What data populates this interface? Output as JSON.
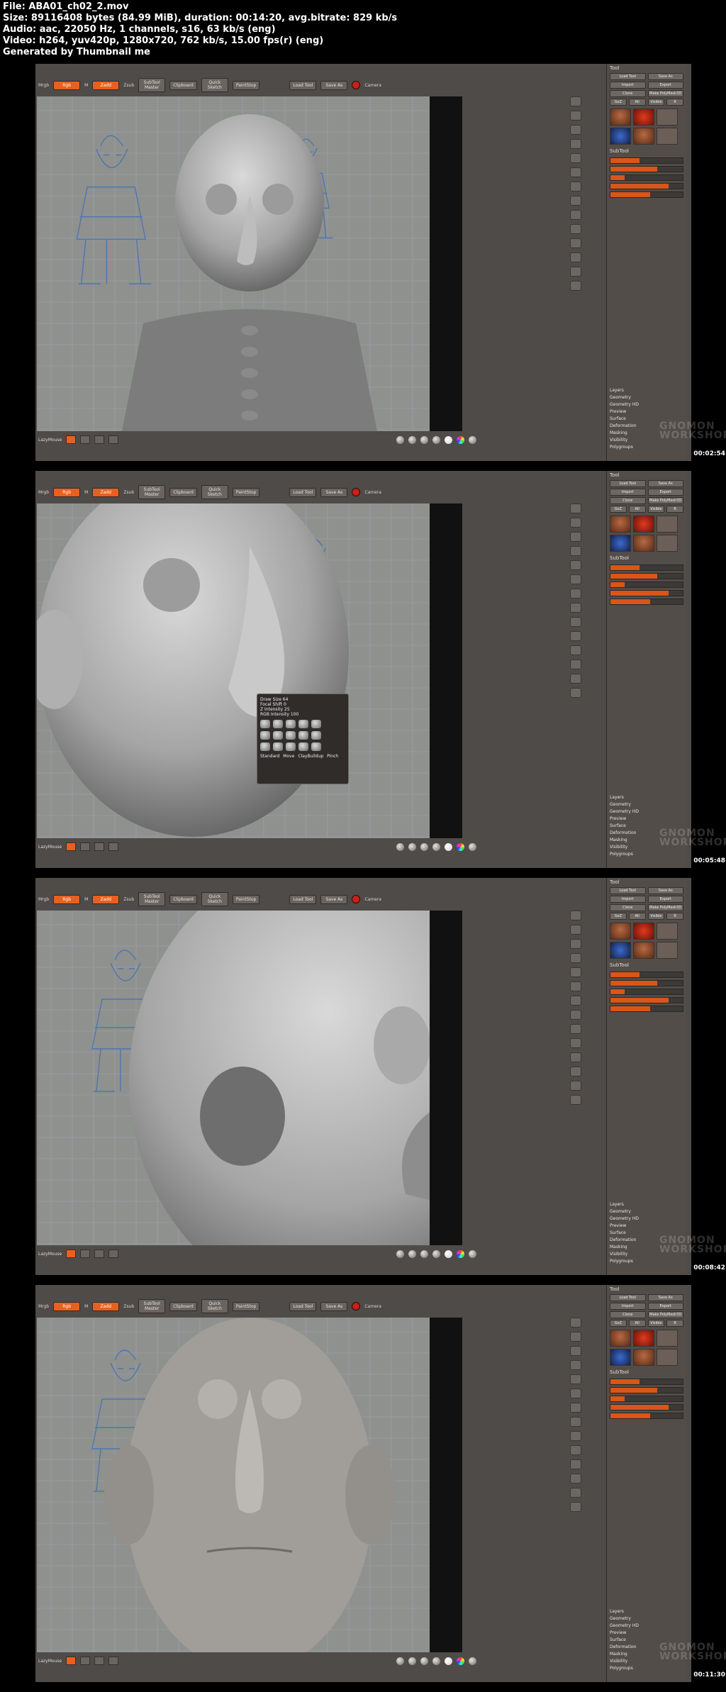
{
  "file_info": {
    "file": "File: ABA01_ch02_2.mov",
    "size": "Size: 89116408 bytes (84.99 MiB), duration: 00:14:20, avg.bitrate: 829 kb/s",
    "audio": "Audio: aac, 22050 Hz, 1 channels, s16, 63 kb/s (eng)",
    "video": "Video: h264, yuv420p, 1280x720, 762 kb/s, 15.00 fps(r) (eng)",
    "generated": "Generated by Thumbnail me"
  },
  "frames": [
    {
      "timestamp": "00:02:54",
      "has_popup": false
    },
    {
      "timestamp": "00:05:48",
      "has_popup": true
    },
    {
      "timestamp": "00:08:42",
      "has_popup": false
    },
    {
      "timestamp": "00:11:30",
      "has_popup": false
    }
  ],
  "watermark": {
    "line1": "GNOMON",
    "line2": "WORKSHOP"
  },
  "toolbar": {
    "mrgb": "Mrgb",
    "rgb": "Rgb",
    "m": "M",
    "zadd": "Zadd",
    "zsub": "Zsub",
    "subtool_master": "SubTool\nMaster",
    "clipboard": "Clipboard",
    "quick_sketch": "Quick\nSketch",
    "paintstop": "PaintStop",
    "load_tool": "Load Tool",
    "save_as": "Save As",
    "import": "Import",
    "export": "Export",
    "camera": "Camera"
  },
  "panel": {
    "title": "Tool",
    "load_tool": "Load Tool",
    "save_as": "Save As",
    "import": "Import",
    "export": "Export",
    "clone": "Clone",
    "make_polymesh": "Make PolyMesh3D",
    "goz": "GoZ",
    "all": "All",
    "visible": "Visible",
    "r": "R",
    "subtool": "SubTool",
    "list": [
      "Layers",
      "Geometry",
      "Geometry HD",
      "Preview",
      "Surface",
      "Deformation",
      "Masking",
      "Visibility",
      "Polygroups"
    ]
  },
  "bottombar": {
    "label": "LazyMouse"
  },
  "popup": {
    "line1": "Draw Size 64",
    "line2": "Focal Shift 0",
    "line3": "Z Intensity 25",
    "line4": "RGB Intensity 100",
    "labels": [
      "Standard",
      "Move",
      "ClayBuildup",
      "Pinch"
    ]
  },
  "colors": {
    "accent": "#e8601f",
    "canvas": "#8f918f",
    "ui_bg": "#4f4b48",
    "sketch_blue": "#3f6fb8"
  }
}
